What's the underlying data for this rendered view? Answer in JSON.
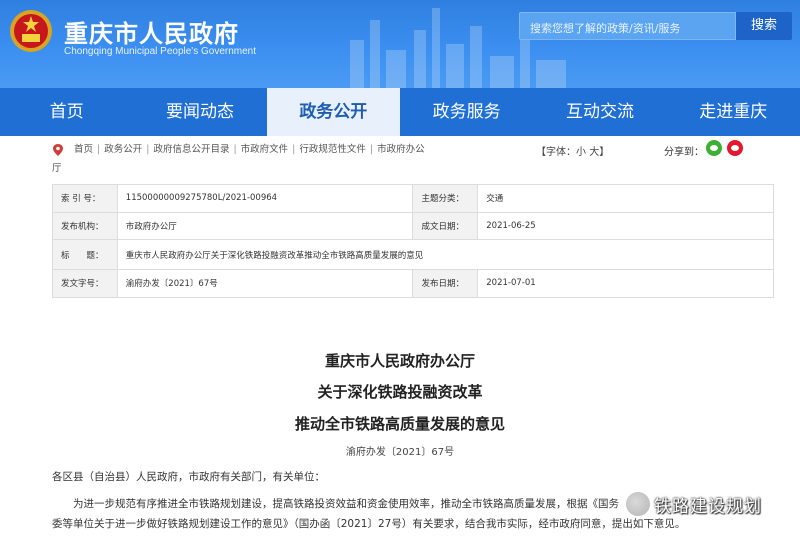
{
  "header": {
    "title": "重庆市人民政府",
    "subtitle": "Chongqing Municipal People's Government",
    "search_placeholder": "搜索您想了解的政策/资讯/服务",
    "search_button": "搜索"
  },
  "nav": [
    "首页",
    "要闻动态",
    "政务公开",
    "政务服务",
    "互动交流",
    "走进重庆"
  ],
  "nav_active_index": 2,
  "breadcrumb": {
    "items": [
      "首页",
      "政务公开",
      "政府信息公开目录",
      "市政府文件",
      "行政规范性文件",
      "市政府办公",
      "厅"
    ]
  },
  "font_size": {
    "label": "【字体：",
    "small": "小",
    "large": "大",
    "close": "】"
  },
  "share": {
    "label": "分享到："
  },
  "meta": {
    "index_label": "索 引 号：",
    "index_value": "11500000009275780L/2021-00964",
    "theme_label": "主题分类：",
    "theme_value": "交通",
    "issuer_label": "发布机构：",
    "issuer_value": "市政府办公厅",
    "date_label": "成文日期：",
    "date_value": "2021-06-25",
    "title_label": "标　　题：",
    "title_value": "重庆市人民政府办公厅关于深化铁路投融资改革推动全市铁路高质量发展的意见",
    "docno_label": "发文字号：",
    "docno_value": "渝府办发〔2021〕67号",
    "pub_label": "发布日期：",
    "pub_value": "2021-07-01"
  },
  "document": {
    "title1": "重庆市人民政府办公厅",
    "title2": "关于深化铁路投融资改革",
    "title3": "推动全市铁路高质量发展的意见",
    "doc_no": "渝府办发〔2021〕67号",
    "salutation": "各区县（自治县）人民政府，市政府有关部门，有关单位：",
    "para1": "为进一步规范有序推进全市铁路规划建设，提高铁路投资效益和资金使用效率，推动全市铁路高质量发展，根据《国务",
    "para2": "委等单位关于进一步做好铁路规划建设工作的意见》（国办函〔2021〕27号）有关要求，结合我市实际，经市政府同意，提出如下意见。"
  },
  "watermark": {
    "text": "铁路建设规划"
  },
  "colors": {
    "header_blue": "#3b8ff0",
    "nav_blue": "#1f6fd4",
    "active_tab_bg": "#e8f0fb"
  }
}
